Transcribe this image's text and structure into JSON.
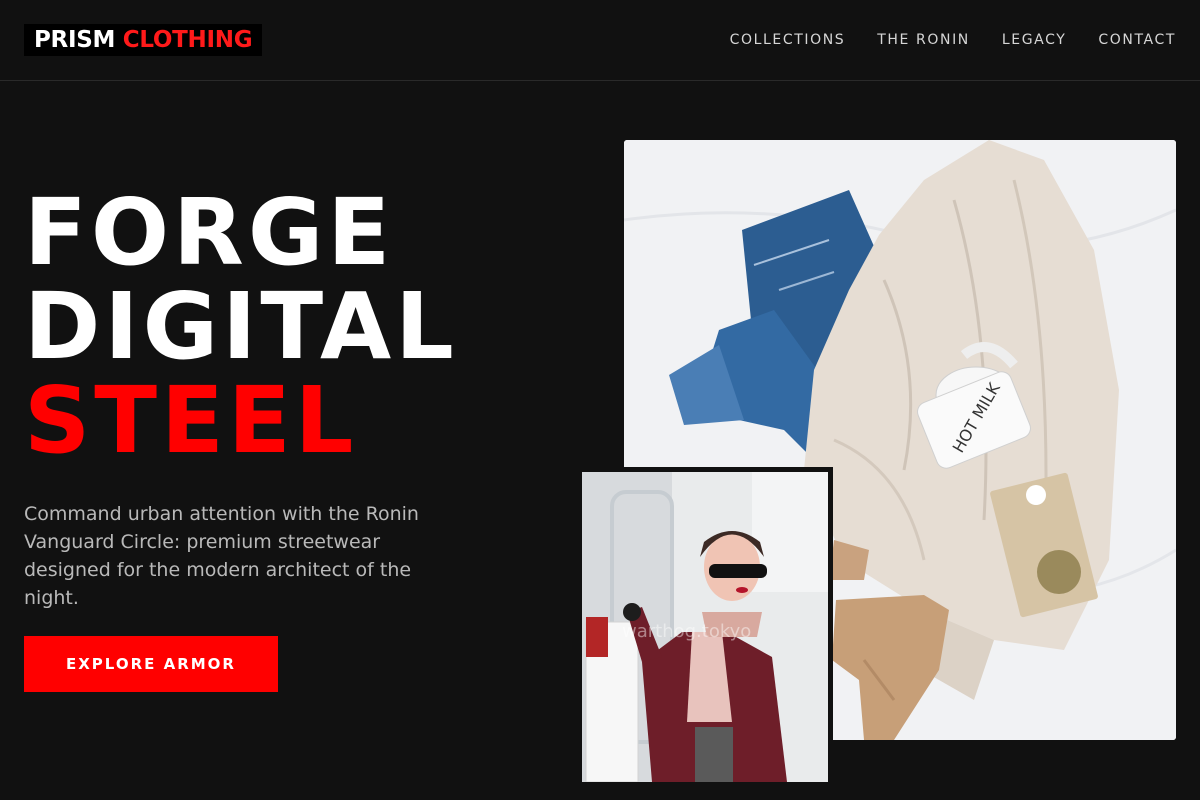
{
  "brand": {
    "name_part1": "PRISM",
    "name_part2": "CLOTHING"
  },
  "nav": {
    "items": [
      "COLLECTIONS",
      "THE RONIN",
      "LEGACY",
      "CONTACT"
    ]
  },
  "hero": {
    "title_line1": "FORGE",
    "title_line2": "DIGITAL",
    "title_line3": "STEEL",
    "description": "Command urban attention with the Ronin Vanguard Circle: premium streetwear designed for the modern architect of the night.",
    "cta_label": "EXPLORE ARMOR"
  },
  "images": {
    "mug_text": "HOT MILK",
    "watermark": "warthog.tokyo"
  },
  "colors": {
    "background": "#111111",
    "accent": "#ff0000",
    "text": "#ffffff",
    "muted": "#b9b9b9"
  }
}
